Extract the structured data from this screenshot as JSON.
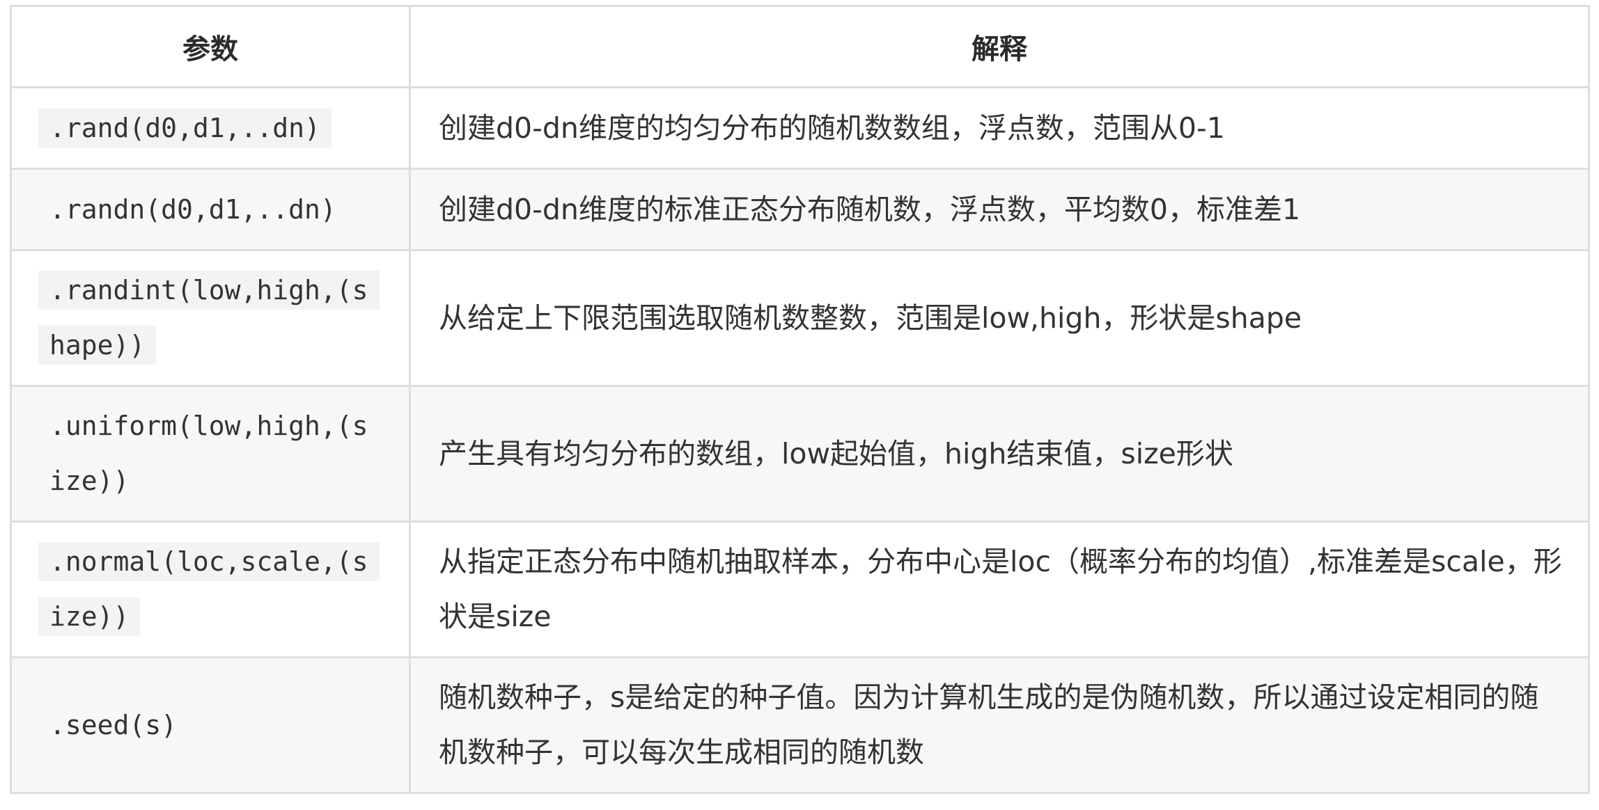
{
  "table": {
    "headers": [
      "参数",
      "解释"
    ],
    "rows": [
      {
        "param": ".rand(d0,d1,..dn)",
        "desc": "创建d0-dn维度的均匀分布的随机数数组，浮点数，范围从0-1"
      },
      {
        "param": ".randn(d0,d1,..dn)",
        "desc": "创建d0-dn维度的标准正态分布随机数，浮点数，平均数0，标准差1"
      },
      {
        "param": ".randint(low,high,(shape))",
        "desc": "从给定上下限范围选取随机数整数，范围是low,high，形状是shape"
      },
      {
        "param": ".uniform(low,high,(size))",
        "desc": "产生具有均匀分布的数组，low起始值，high结束值，size形状"
      },
      {
        "param": ".normal(loc,scale,(size))",
        "desc": "从指定正态分布中随机抽取样本，分布中心是loc（概率分布的均值）,标准差是scale，形状是size"
      },
      {
        "param": ".seed(s)",
        "desc": "随机数种子，s是给定的种子值。因为计算机生成的是伪随机数，所以通过设定相同的随机数种子，可以每次生成相同的随机数"
      }
    ]
  }
}
